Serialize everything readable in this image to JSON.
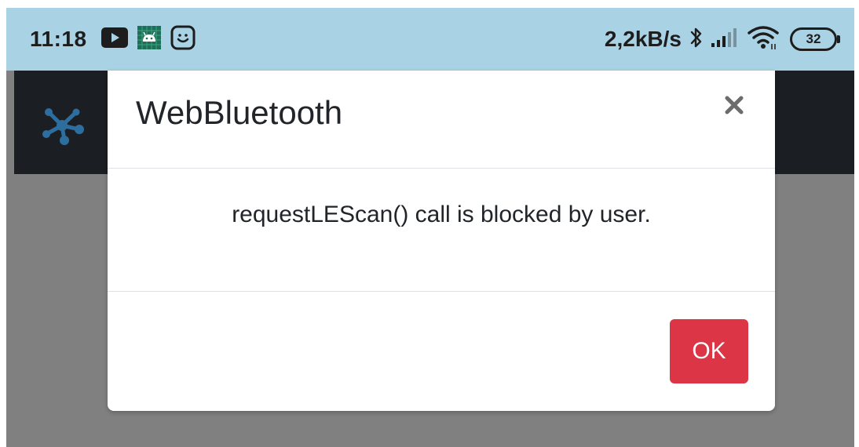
{
  "status_bar": {
    "time": "11:18",
    "network_speed": "2,2kB/s",
    "battery_level": "32",
    "icons": [
      "youtube-icon",
      "android-studio-icon",
      "smile-app-icon",
      "bluetooth-icon",
      "signal-icon",
      "wifi-icon",
      "battery-icon"
    ]
  },
  "app_bar": {
    "logo_icon": "network-graph-icon"
  },
  "dialog": {
    "title": "WebBluetooth",
    "message": "requestLEScan() call is blocked by user.",
    "ok_label": "OK",
    "close_icon": "close-icon"
  },
  "colors": {
    "status_bar_bg": "#a9d3e4",
    "overlay_bg": "#808080",
    "app_bar_bg": "#1b1f23",
    "logo_color": "#2d6e9e",
    "ok_button_bg": "#dc3545",
    "close_icon_color": "#6c6c6c"
  }
}
